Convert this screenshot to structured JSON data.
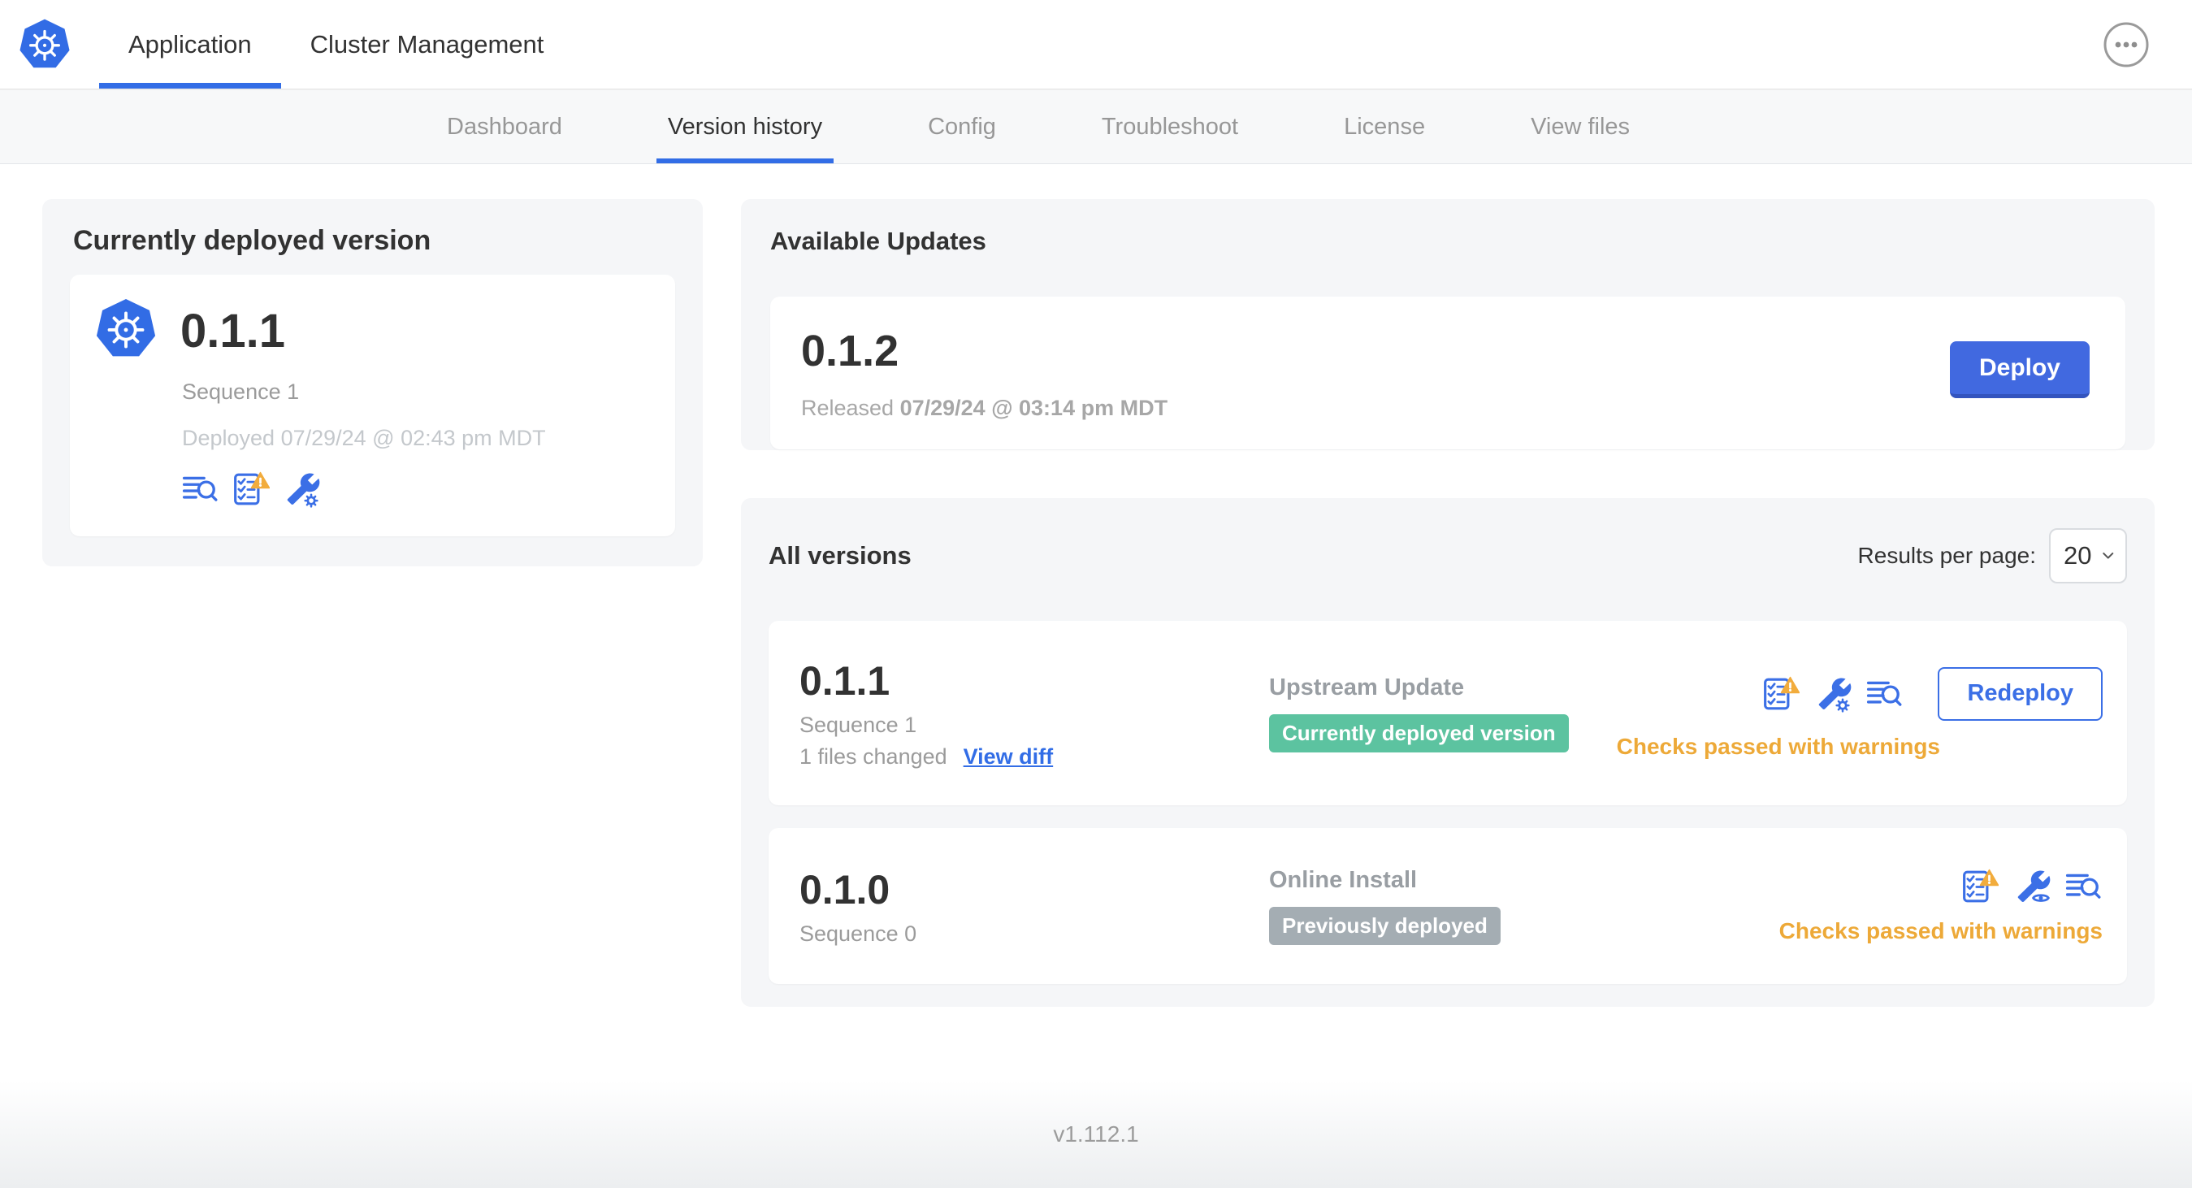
{
  "header": {
    "tabs": [
      {
        "label": "Application",
        "active": true
      },
      {
        "label": "Cluster Management",
        "active": false
      }
    ],
    "more_button_icon": "ellipsis-in-circle-icon"
  },
  "subnav": {
    "tabs": [
      {
        "label": "Dashboard",
        "active": false
      },
      {
        "label": "Version history",
        "active": true
      },
      {
        "label": "Config",
        "active": false
      },
      {
        "label": "Troubleshoot",
        "active": false
      },
      {
        "label": "License",
        "active": false
      },
      {
        "label": "View files",
        "active": false
      }
    ]
  },
  "current_version_card": {
    "title": "Currently deployed version",
    "version": "0.1.1",
    "sequence": "Sequence 1",
    "deployed": "Deployed 07/29/24 @ 02:43 pm MDT",
    "icons": [
      "logs-icon",
      "preflight-checks-warning-icon",
      "config-edit-icon"
    ]
  },
  "available_updates": {
    "title": "Available Updates",
    "version": "0.1.2",
    "released_prefix": "Released",
    "released_datetime": "07/29/24 @ 03:14 pm MDT",
    "deploy_label": "Deploy"
  },
  "all_versions": {
    "title": "All versions",
    "results_per_page_label": "Results per page:",
    "results_per_page_value": "20",
    "rows": [
      {
        "version": "0.1.1",
        "sequence": "Sequence 1",
        "files_changed": "1 files changed",
        "view_diff_label": "View diff",
        "source": "Upstream Update",
        "badge": "Currently deployed version",
        "badge_type": "success",
        "icons": [
          "preflight-checks-warning-icon",
          "config-edit-icon",
          "logs-icon"
        ],
        "action_label": "Redeploy",
        "status": "Checks passed with warnings"
      },
      {
        "version": "0.1.0",
        "sequence": "Sequence 0",
        "source": "Online Install",
        "badge": "Previously deployed",
        "badge_type": "muted",
        "icons": [
          "preflight-checks-warning-icon",
          "config-view-icon",
          "logs-icon"
        ],
        "status": "Checks passed with warnings"
      }
    ]
  },
  "footer": {
    "version": "v1.112.1"
  },
  "colors": {
    "accent_blue": "#326DE6",
    "button_blue": "#4169E0",
    "success_green": "#5CC3A0",
    "muted_badge_gray": "#A4ADB3",
    "warning_orange": "#EDA938",
    "panel_gray": "#F5F6F8"
  }
}
